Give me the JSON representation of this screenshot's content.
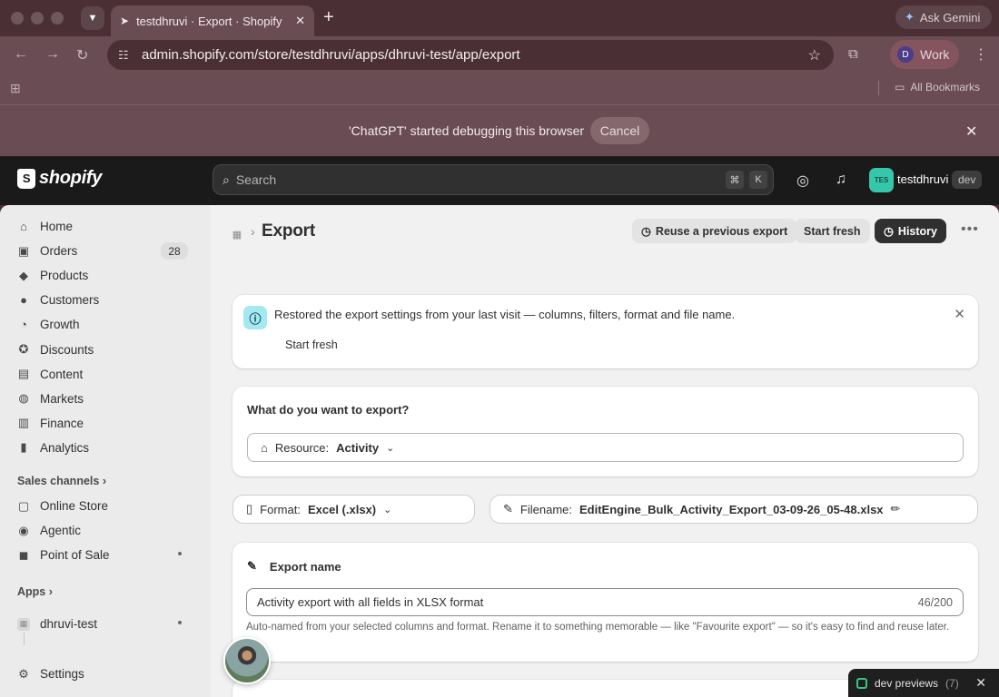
{
  "browser": {
    "tab_title": "testdhruvi · Export · Shopify",
    "new_tab_label": "+",
    "ask_gemini": "Ask Gemini",
    "url": "admin.shopify.com/store/testdhruvi/apps/dhruvi-test/app/export",
    "profile_initial": "D",
    "profile_name": "Work",
    "all_bookmarks": "All Bookmarks",
    "debug_message": "'ChatGPT' started debugging this browser",
    "debug_cancel": "Cancel"
  },
  "shopify": {
    "logo_text": "shopify",
    "search_placeholder": "Search",
    "shortcut_cmd": "⌘",
    "shortcut_key": "K",
    "store_initials": "TES",
    "store_name": "testdhruvi",
    "store_badge": "dev"
  },
  "sidebar": {
    "items": [
      {
        "label": "Home",
        "icon": "home-icon",
        "glyph": "⌂"
      },
      {
        "label": "Orders",
        "icon": "inbox-icon",
        "glyph": "▣",
        "badge": "28"
      },
      {
        "label": "Products",
        "icon": "tag-icon",
        "glyph": "◆"
      },
      {
        "label": "Customers",
        "icon": "person-icon",
        "glyph": "●"
      },
      {
        "label": "Growth",
        "icon": "growth-icon",
        "glyph": "◔"
      },
      {
        "label": "Discounts",
        "icon": "discount-icon",
        "glyph": "✪"
      },
      {
        "label": "Content",
        "icon": "content-icon",
        "glyph": "▤"
      },
      {
        "label": "Markets",
        "icon": "globe-icon",
        "glyph": "◍"
      },
      {
        "label": "Finance",
        "icon": "bank-icon",
        "glyph": "▥"
      },
      {
        "label": "Analytics",
        "icon": "bar-chart-icon",
        "glyph": "▮"
      }
    ],
    "sales_channels_label": "Sales channels",
    "sales_channels": [
      {
        "label": "Online Store",
        "icon": "store-icon",
        "glyph": "▢"
      },
      {
        "label": "Agentic",
        "icon": "agentic-icon",
        "glyph": "◉"
      },
      {
        "label": "Point of Sale",
        "icon": "pos-icon",
        "glyph": "◼"
      }
    ],
    "apps_label": "Apps",
    "app_item": "dhruvi-test",
    "settings": "Settings"
  },
  "page": {
    "title": "Export",
    "actions": {
      "reuse": "Reuse a previous export",
      "start_fresh": "Start fresh",
      "history": "History"
    },
    "banner": {
      "text": "Restored the export settings from your last visit — columns, filters, format and file name.",
      "link": "Start fresh"
    },
    "export_section": {
      "heading": "What do you want to export?",
      "resource_label": "Resource:",
      "resource_value": "Activity"
    },
    "format": {
      "label": "Format:",
      "value": "Excel (.xlsx)"
    },
    "filename": {
      "label": "Filename:",
      "value": "EditEngine_Bulk_Activity_Export_03-09-26_05-48.xlsx"
    },
    "export_name": {
      "heading": "Export name",
      "value": "Activity export with all fields in XLSX format",
      "counter": "46/200",
      "help": "Auto-named from your selected columns and format. Rename it to something memorable — like \"Favourite export\" — so it's easy to find and reuse later."
    }
  },
  "dev_previews": {
    "label": "dev previews",
    "count": "(7)"
  },
  "colors": {
    "chrome": "#4a2f35",
    "shopify_bar": "#1a1a1a",
    "accent_info": "#a4e8f2",
    "store_avatar": "#35c7a9"
  }
}
